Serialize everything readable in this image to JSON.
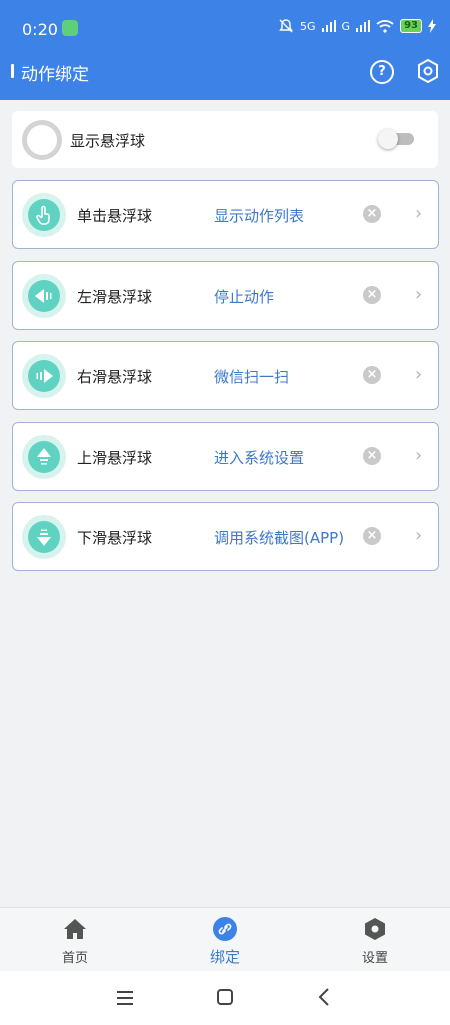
{
  "status": {
    "time": "0:20",
    "net1": "5G",
    "net2": "G",
    "battery": "93"
  },
  "header": {
    "title": "动作绑定",
    "help_symbol": "?"
  },
  "toggle_row": {
    "label": "显示悬浮球",
    "enabled": false
  },
  "bindings": [
    {
      "gesture": "单击悬浮球",
      "action": "显示动作列表",
      "icon": "tap-icon"
    },
    {
      "gesture": "左滑悬浮球",
      "action": "停止动作",
      "icon": "swipe-left-icon"
    },
    {
      "gesture": "右滑悬浮球",
      "action": "微信扫一扫",
      "icon": "swipe-right-icon"
    },
    {
      "gesture": "上滑悬浮球",
      "action": "进入系统设置",
      "icon": "swipe-up-icon"
    },
    {
      "gesture": "下滑悬浮球",
      "action": "调用系统截图(APP)",
      "icon": "swipe-down-icon"
    }
  ],
  "clear_symbol": "×",
  "chevron_symbol": "›",
  "bottom_nav": [
    {
      "label": "首页",
      "icon": "home-icon",
      "active": false
    },
    {
      "label": "绑定",
      "icon": "link-icon",
      "active": true
    },
    {
      "label": "设置",
      "icon": "settings-icon",
      "active": false
    }
  ],
  "colors": {
    "primary": "#3d82e6",
    "accent_text": "#3d79c8",
    "teal": "#5fd2c2"
  }
}
